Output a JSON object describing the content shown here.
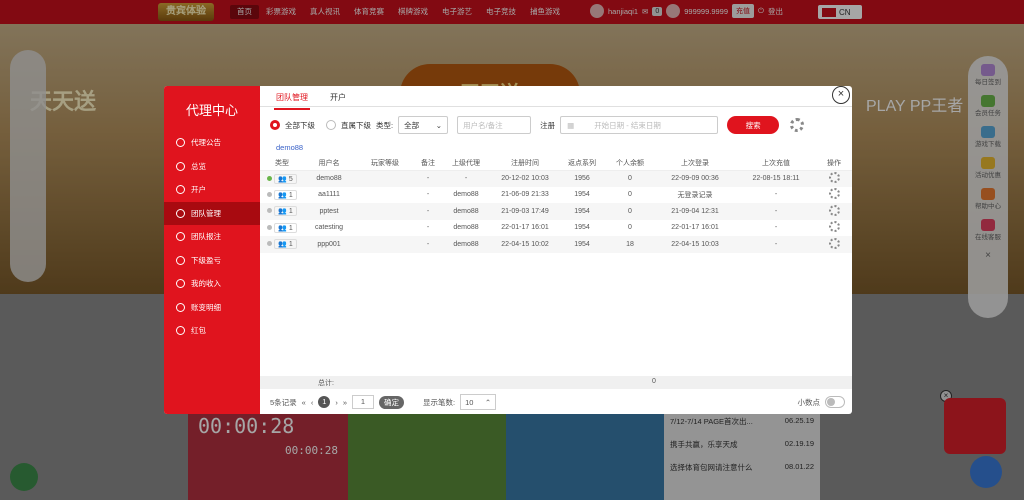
{
  "logo": "贵宾体验",
  "nav": [
    "首页",
    "彩票游戏",
    "真人视讯",
    "体育竞赛",
    "棋牌游戏",
    "电子游艺",
    "电子竞技",
    "捕鱼游戏"
  ],
  "user": {
    "name": "hanjiaqi1",
    "msg_count": "0",
    "balance": "999999.9999",
    "deposit": "充值",
    "logout": "登出",
    "lang": "CN"
  },
  "banner": {
    "left_text": "天天送",
    "mid_text": "天天送",
    "right_text": "PLAY PP王者"
  },
  "float_right": [
    "每日签到",
    "会员任务",
    "游戏下载",
    "活动优惠",
    "帮助中心",
    "在线客服"
  ],
  "timer": {
    "value": "00:00:28",
    "value2": "00:00:28"
  },
  "news": [
    {
      "title": "7/12-7/14 PAGE首次出...",
      "date": "06.25.19"
    },
    {
      "title": "携手共赢，乐享天成",
      "date": "02.19.19"
    },
    {
      "title": "选择体育包网请注意什么",
      "date": "08.01.22"
    }
  ],
  "modal": {
    "title": "代理中心",
    "side_items": [
      "代理公告",
      "总览",
      "开户",
      "团队管理",
      "团队报注",
      "下级盈亏",
      "我的收入",
      "账变明细",
      "红包"
    ],
    "active_side": 3,
    "tabs": [
      "团队管理",
      "开户"
    ],
    "filters": {
      "radio_all": "全部下级",
      "radio_direct": "直属下级",
      "type_label": "类型:",
      "type_value": "全部",
      "user_placeholder": "用户名/备注",
      "reg_label": "注册",
      "date_start": "开始日期",
      "date_sep": "-",
      "date_end": "结束日期",
      "search": "搜索"
    },
    "crumb": "demo88",
    "columns": [
      "类型",
      "用户名",
      "玩家等级",
      "备注",
      "上级代理",
      "注册时间",
      "返点系列",
      "个人余额",
      "上次登录",
      "上次充值",
      "操作"
    ],
    "rows": [
      {
        "online": true,
        "count": "5",
        "user": "demo88",
        "level": "",
        "note": "-",
        "parent": "-",
        "reg": "20-12-02 10:03",
        "rebate": "1956",
        "balance": "0",
        "last_login": "22-09-09 00:36",
        "last_dep": "22-08-15 18:11"
      },
      {
        "online": false,
        "count": "1",
        "user": "aa1111",
        "level": "",
        "note": "-",
        "parent": "demo88",
        "reg": "21-06-09 21:33",
        "rebate": "1954",
        "balance": "0",
        "last_login": "无登录记录",
        "last_dep": "-"
      },
      {
        "online": false,
        "count": "1",
        "user": "pptest",
        "level": "",
        "note": "-",
        "parent": "demo88",
        "reg": "21-09-03 17:49",
        "rebate": "1954",
        "balance": "0",
        "last_login": "21-09-04 12:31",
        "last_dep": "-"
      },
      {
        "online": false,
        "count": "1",
        "user": "catesting",
        "level": "",
        "note": "-",
        "parent": "demo88",
        "reg": "22-01-17 16:01",
        "rebate": "1954",
        "balance": "0",
        "last_login": "22-01-17 16:01",
        "last_dep": "-"
      },
      {
        "online": false,
        "count": "1",
        "user": "ppp001",
        "level": "",
        "note": "-",
        "parent": "demo88",
        "reg": "22-04-15 10:02",
        "rebate": "1954",
        "balance": "18",
        "last_login": "22-04-15 10:03",
        "last_dep": "-"
      }
    ],
    "total_label": "总计:",
    "total_value": "0",
    "pager": {
      "records": "5条记录",
      "page": "1",
      "goto": "1",
      "go": "确定",
      "size_label": "显示笔数:",
      "size": "10",
      "decimal": "小数点"
    }
  }
}
